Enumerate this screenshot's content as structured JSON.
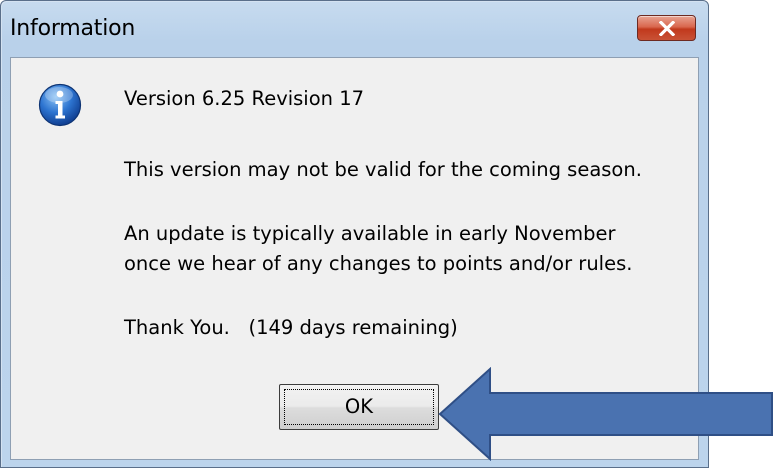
{
  "window": {
    "title": "Information",
    "close_icon": "close-x-icon"
  },
  "message": {
    "icon": "info-icon",
    "lines": [
      "Version 6.25 Revision 17",
      "This version may not be valid for the coming season.",
      "An update is typically available in early November",
      "once we hear of any changes to points and/or rules.",
      "Thank You.   (149 days remaining)"
    ]
  },
  "buttons": {
    "ok_label": "OK"
  },
  "annotation": {
    "icon": "arrow-left-icon",
    "color": "#4a72b0"
  },
  "colors": {
    "close_button": "#c7412a",
    "title_bar": "#b9d1ea",
    "client_background": "#f0f0f0"
  }
}
